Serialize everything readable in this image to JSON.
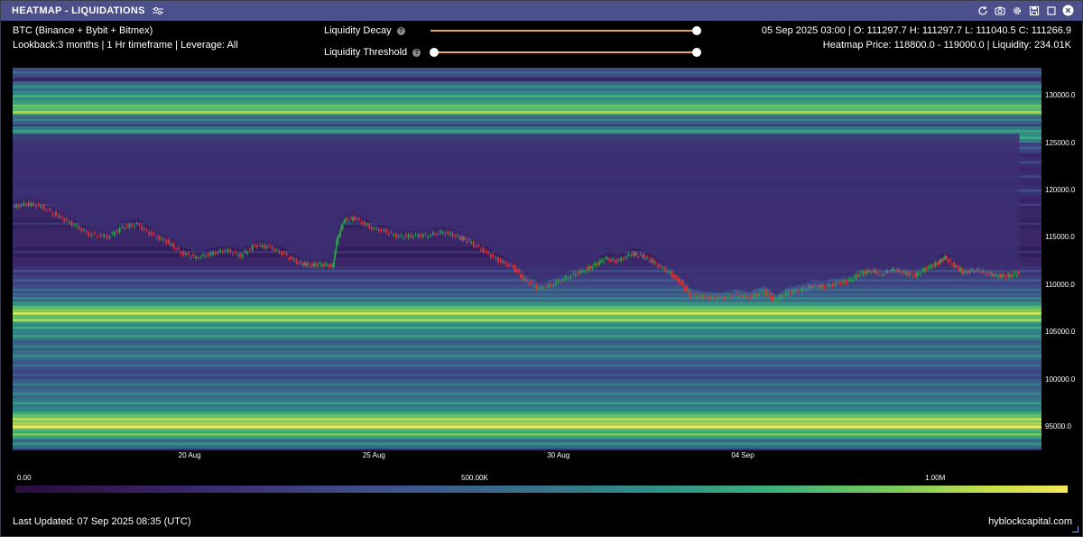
{
  "window": {
    "title": "HEATMAP - LIQUIDATIONS",
    "title_icon": "sliders-icon",
    "toolbar_icons": [
      "refresh-icon",
      "camera-icon",
      "gear-icon",
      "save-icon",
      "expand-icon",
      "close-icon"
    ]
  },
  "info": {
    "line1": "BTC (Binance + Bybit + Bitmex)",
    "line2": "Lookback:3 months | 1 Hr timeframe | Leverage: All",
    "ohlc": "05 Sep 2025 03:00 | O: 111297.7 H: 111297.7 L: 111040.5 C: 111266.9",
    "heatmap_info": "Heatmap Price: 118800.0 - 119000.0 | Liquidity: 234.01K"
  },
  "controls": {
    "decay_label": "Liquidity Decay",
    "threshold_label": "Liquidity Threshold",
    "decay_value": 1.0,
    "threshold_range": [
      0.0,
      1.0
    ]
  },
  "colorbar": {
    "labels": [
      "0.00",
      "500.00K",
      "1.00M"
    ],
    "min": 0,
    "max": 1170000
  },
  "footer": {
    "updated": "Last Updated: 07 Sep 2025 08:35 (UTC)",
    "brand": "hyblockcapital.com"
  },
  "colors": {
    "titlebar": "#4b4f8a",
    "slider_track": "#e8a56a",
    "candle_up": "#2e9e4f",
    "candle_down": "#d8343c"
  },
  "chart_data": {
    "type": "heatmap",
    "overlay": "candlestick",
    "x_ticks": [
      "20 Aug",
      "25 Aug",
      "30 Aug",
      "04 Sep"
    ],
    "y_ticks": [
      "130000.0",
      "125000.0",
      "120000.0",
      "115000.0",
      "110000.0",
      "105000.0",
      "100000.0",
      "95000.0"
    ],
    "ylim": [
      92500,
      133000
    ],
    "xlim_days": [
      15.2,
      36.2
    ],
    "x_tick_days": [
      20,
      25,
      30,
      35
    ],
    "price_path": [
      [
        15.2,
        118200
      ],
      [
        15.6,
        118600
      ],
      [
        16.0,
        118300
      ],
      [
        16.5,
        117200
      ],
      [
        16.9,
        116300
      ],
      [
        17.3,
        115400
      ],
      [
        17.8,
        115100
      ],
      [
        18.2,
        116100
      ],
      [
        18.6,
        116400
      ],
      [
        19.0,
        115300
      ],
      [
        19.4,
        114600
      ],
      [
        19.8,
        113400
      ],
      [
        20.2,
        112900
      ],
      [
        20.6,
        113300
      ],
      [
        21.0,
        113700
      ],
      [
        21.4,
        113100
      ],
      [
        21.8,
        114200
      ],
      [
        22.2,
        114000
      ],
      [
        22.6,
        113200
      ],
      [
        23.0,
        112300
      ],
      [
        23.3,
        112100
      ],
      [
        23.6,
        112200
      ],
      [
        23.9,
        112000
      ],
      [
        24.0,
        114600
      ],
      [
        24.2,
        116800
      ],
      [
        24.5,
        117100
      ],
      [
        24.9,
        116100
      ],
      [
        25.3,
        115700
      ],
      [
        25.7,
        115100
      ],
      [
        26.1,
        115200
      ],
      [
        26.5,
        115300
      ],
      [
        26.9,
        115600
      ],
      [
        27.3,
        115100
      ],
      [
        27.6,
        114600
      ],
      [
        28.0,
        113600
      ],
      [
        28.4,
        112600
      ],
      [
        28.8,
        111900
      ],
      [
        29.1,
        110500
      ],
      [
        29.5,
        109600
      ],
      [
        29.9,
        110100
      ],
      [
        30.3,
        110900
      ],
      [
        30.7,
        111500
      ],
      [
        31.0,
        112100
      ],
      [
        31.3,
        112800
      ],
      [
        31.6,
        112500
      ],
      [
        32.0,
        113300
      ],
      [
        32.3,
        113100
      ],
      [
        32.6,
        112400
      ],
      [
        33.0,
        111400
      ],
      [
        33.3,
        110400
      ],
      [
        33.6,
        108900
      ],
      [
        34.0,
        108700
      ],
      [
        34.4,
        108600
      ],
      [
        34.8,
        108900
      ],
      [
        35.2,
        108700
      ],
      [
        35.6,
        109300
      ],
      [
        35.9,
        108300
      ],
      [
        36.2,
        109100
      ],
      [
        36.6,
        109500
      ],
      [
        36.9,
        109900
      ],
      [
        37.2,
        109800
      ],
      [
        37.6,
        110200
      ],
      [
        37.9,
        110400
      ],
      [
        38.2,
        111200
      ],
      [
        38.5,
        111500
      ],
      [
        38.8,
        111200
      ],
      [
        39.1,
        111600
      ],
      [
        39.4,
        111300
      ],
      [
        39.7,
        111000
      ],
      [
        40.0,
        111800
      ],
      [
        40.3,
        112300
      ],
      [
        40.5,
        112900
      ],
      [
        40.8,
        111900
      ],
      [
        41.0,
        111300
      ],
      [
        41.3,
        111600
      ],
      [
        41.6,
        111300
      ],
      [
        41.9,
        111000
      ],
      [
        42.2,
        110900
      ],
      [
        42.5,
        111266
      ]
    ],
    "liquidity_bands": [
      {
        "price": 132500,
        "level": 0.35
      },
      {
        "price": 131000,
        "level": 0.5
      },
      {
        "price": 130000,
        "level": 0.62
      },
      {
        "price": 129000,
        "level": 0.7
      },
      {
        "price": 128300,
        "level": 0.78
      },
      {
        "price": 127500,
        "level": 0.45
      },
      {
        "price": 126300,
        "level": 0.55
      },
      {
        "price": 125600,
        "level": 0.6
      },
      {
        "price": 124500,
        "level": 0.3
      },
      {
        "price": 123000,
        "level": 0.2
      },
      {
        "price": 121500,
        "level": 0.18
      },
      {
        "price": 120000,
        "level": 0.22
      },
      {
        "price": 118500,
        "level": 0.15
      },
      {
        "price": 116500,
        "level": 0.12
      },
      {
        "price": 113500,
        "level": 0.1
      },
      {
        "price": 111500,
        "level": 0.22
      },
      {
        "price": 110500,
        "level": 0.28
      },
      {
        "price": 109500,
        "level": 0.35
      },
      {
        "price": 108600,
        "level": 0.45
      },
      {
        "price": 107700,
        "level": 0.65
      },
      {
        "price": 107000,
        "level": 0.85
      },
      {
        "price": 106300,
        "level": 0.78
      },
      {
        "price": 105500,
        "level": 0.6
      },
      {
        "price": 104600,
        "level": 0.55
      },
      {
        "price": 103500,
        "level": 0.45
      },
      {
        "price": 102500,
        "level": 0.5
      },
      {
        "price": 101500,
        "level": 0.38
      },
      {
        "price": 100500,
        "level": 0.3
      },
      {
        "price": 99500,
        "level": 0.42
      },
      {
        "price": 98500,
        "level": 0.48
      },
      {
        "price": 97500,
        "level": 0.55
      },
      {
        "price": 96500,
        "level": 0.6
      },
      {
        "price": 95800,
        "level": 0.82
      },
      {
        "price": 95000,
        "level": 0.9
      },
      {
        "price": 94200,
        "level": 0.72
      },
      {
        "price": 93200,
        "level": 0.5
      }
    ]
  }
}
